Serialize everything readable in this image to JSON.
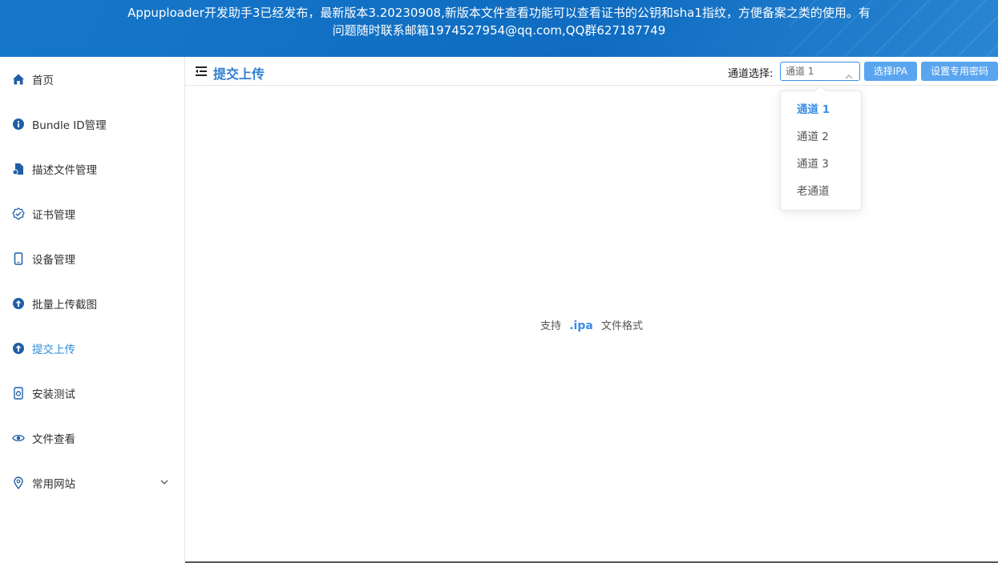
{
  "banner": {
    "message": "Appuploader开发助手3已经发布，最新版本3.20230908,新版本文件查看功能可以查看证书的公钥和sha1指纹，方便备案之类的使用。有问题随时联系邮箱1974527954@qq.com,QQ群627187749"
  },
  "sidebar": {
    "items": [
      {
        "label": "首页",
        "icon": "home-icon"
      },
      {
        "label": "Bundle ID管理",
        "icon": "info-icon"
      },
      {
        "label": "描述文件管理",
        "icon": "file-icon"
      },
      {
        "label": "证书管理",
        "icon": "certificate-icon"
      },
      {
        "label": "设备管理",
        "icon": "phone-icon"
      },
      {
        "label": "批量上传截图",
        "icon": "upload-icon"
      },
      {
        "label": "提交上传",
        "icon": "upload-icon",
        "active": true
      },
      {
        "label": "安装测试",
        "icon": "install-icon"
      },
      {
        "label": "文件查看",
        "icon": "view-icon"
      },
      {
        "label": "常用网站",
        "icon": "location-icon",
        "expandable": true
      }
    ]
  },
  "header": {
    "title": "提交上传",
    "channel_label": "通道选择:",
    "channel_selected": "通道 1",
    "select_ipa_button": "选择IPA",
    "set_password_button": "设置专用密码"
  },
  "dropdown": {
    "options": [
      "通道 1",
      "通道 2",
      "通道 3",
      "老通道"
    ],
    "selected_index": 0
  },
  "drop_zone": {
    "prefix": "支持",
    "extension": ".ipa",
    "suffix": "文件格式"
  },
  "colors": {
    "banner": "#0f6cc0",
    "accent": "#2f8ddb",
    "button": "#5aa5ef"
  }
}
